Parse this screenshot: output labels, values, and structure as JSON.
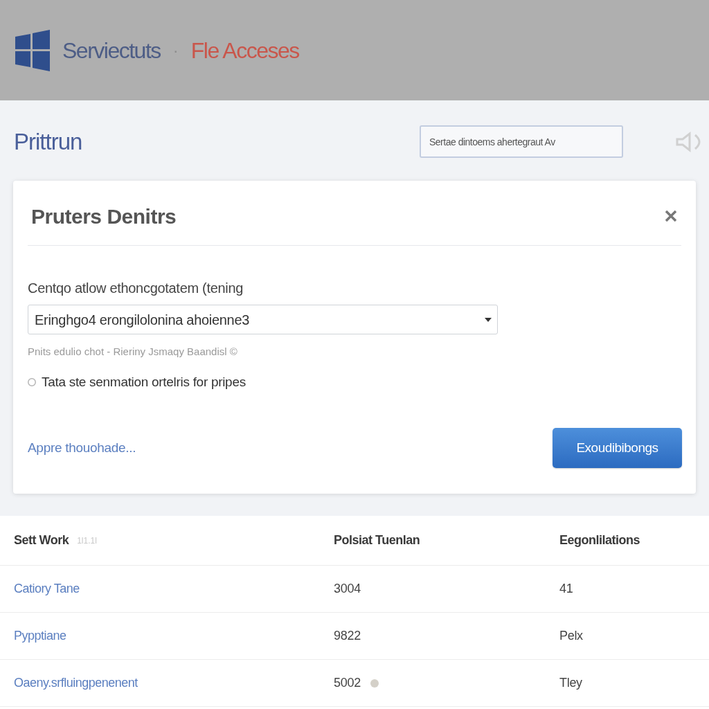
{
  "header": {
    "app_name": "Serviectuts",
    "separator": "·",
    "breadcrumb": "Fle Acceses"
  },
  "toolbar": {
    "title": "Prittrun",
    "search": {
      "value": "Sertae dintoems ahertegraut Av"
    }
  },
  "dialog": {
    "title": "Pruters Denitrs",
    "field_label": "Centqo atlow ethoncgotatem (tening",
    "select_value": "Eringhgo4 erongilolonina ahoienne3",
    "hint": "Pnits edulio chot - Rieriny Jsmaqy Baandisl ©",
    "option": {
      "label": "Tata ste senmation ortelris for pripes",
      "checked": false
    },
    "link": "Appre thouohade...",
    "button": "Exoudibibongs"
  },
  "table": {
    "columns": [
      {
        "label": "Sett Work",
        "note": "1l1.1l"
      },
      {
        "label": "Polsiat Tuenlan"
      },
      {
        "label": "Eegonlilations"
      }
    ],
    "rows": [
      {
        "cells": [
          "Catiory Tane",
          "3004",
          "41"
        ],
        "marker": false
      },
      {
        "cells": [
          "Pypptiane",
          "9822",
          "Pelx"
        ],
        "marker": false
      },
      {
        "cells": [
          "Oaeny.srfluingpenenent",
          "5002",
          "Tley"
        ],
        "marker": true
      }
    ]
  }
}
